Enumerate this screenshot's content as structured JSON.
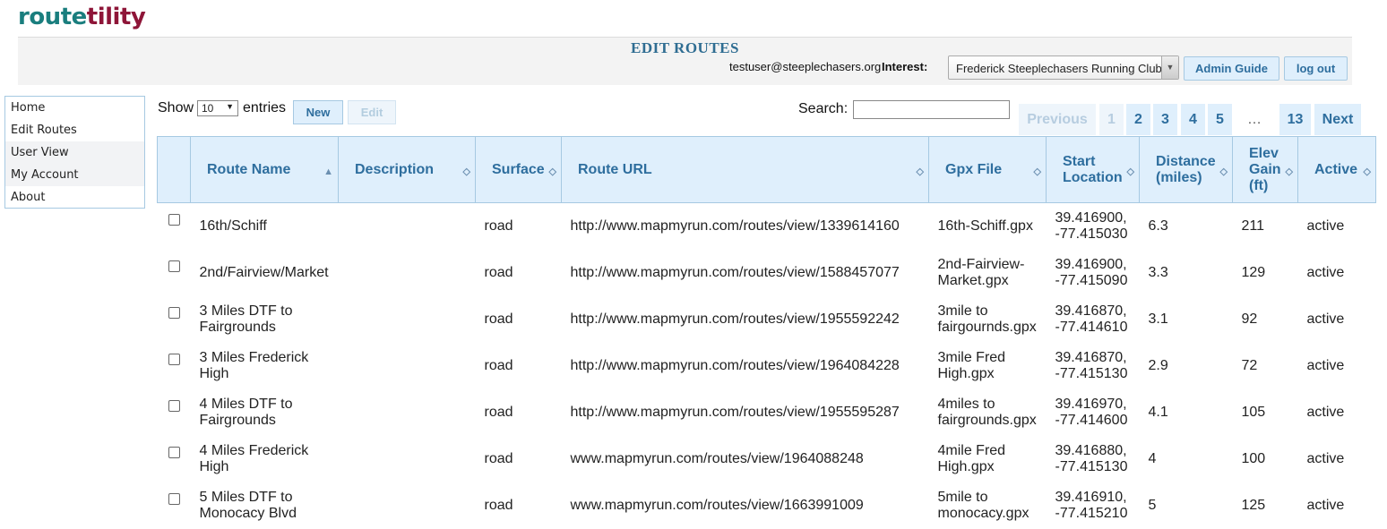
{
  "logo": {
    "part1": "route",
    "part2": "tility"
  },
  "header": {
    "title": "EDIT ROUTES",
    "user_email": "testuser@steeplechasers.org",
    "interest_label": "Interest:",
    "interest_value": "Frederick Steeplechasers Running Club",
    "admin_guide_label": "Admin Guide",
    "logout_label": "log out"
  },
  "nav": {
    "items": [
      "Home",
      "Edit Routes",
      "User View",
      "My Account",
      "About"
    ]
  },
  "toolbar": {
    "show_label": "Show",
    "entries_value": "10",
    "entries_label": "entries",
    "new_label": "New",
    "edit_label": "Edit",
    "search_label": "Search:",
    "search_value": ""
  },
  "pagination": {
    "previous": "Previous",
    "pages": [
      "1",
      "2",
      "3",
      "4",
      "5"
    ],
    "ellipsis": "…",
    "last": "13",
    "next": "Next",
    "current_page": "1"
  },
  "table": {
    "columns": [
      "Route Name",
      "Description",
      "Surface",
      "Route URL",
      "Gpx File",
      "Start Location",
      "Distance (miles)",
      "Elev Gain (ft)",
      "Active"
    ],
    "rows": [
      {
        "name": "16th/Schiff",
        "description": "",
        "surface": "road",
        "url": "http://www.mapmyrun.com/routes/view/1339614160",
        "gpx": "16th-Schiff.gpx",
        "start": "39.416900, -77.415030",
        "distance": "6.3",
        "elev": "211",
        "active": "active"
      },
      {
        "name": "2nd/Fairview/Market",
        "description": "",
        "surface": "road",
        "url": "http://www.mapmyrun.com/routes/view/1588457077",
        "gpx": "2nd-Fairview-Market.gpx",
        "start": "39.416900, -77.415090",
        "distance": "3.3",
        "elev": "129",
        "active": "active"
      },
      {
        "name": "3 Miles DTF to Fairgrounds",
        "description": "",
        "surface": "road",
        "url": "http://www.mapmyrun.com/routes/view/1955592242",
        "gpx": "3mile to fairgournds.gpx",
        "start": "39.416870, -77.414610",
        "distance": "3.1",
        "elev": "92",
        "active": "active"
      },
      {
        "name": "3 Miles Frederick High",
        "description": "",
        "surface": "road",
        "url": "http://www.mapmyrun.com/routes/view/1964084228",
        "gpx": "3mile Fred High.gpx",
        "start": "39.416870, -77.415130",
        "distance": "2.9",
        "elev": "72",
        "active": "active"
      },
      {
        "name": "4 Miles DTF to Fairgrounds",
        "description": "",
        "surface": "road",
        "url": "http://www.mapmyrun.com/routes/view/1955595287",
        "gpx": "4miles to fairgrounds.gpx",
        "start": "39.416970, -77.414600",
        "distance": "4.1",
        "elev": "105",
        "active": "active"
      },
      {
        "name": "4 Miles Frederick High",
        "description": "",
        "surface": "road",
        "url": "www.mapmyrun.com/routes/view/1964088248",
        "gpx": "4mile Fred High.gpx",
        "start": "39.416880, -77.415130",
        "distance": "4",
        "elev": "100",
        "active": "active"
      },
      {
        "name": "5 Miles DTF to Monocacy Blvd",
        "description": "",
        "surface": "road",
        "url": "www.mapmyrun.com/routes/view/1663991009",
        "gpx": "5mile to monocacy.gpx",
        "start": "39.416910, -77.415210",
        "distance": "5",
        "elev": "125",
        "active": "active"
      }
    ]
  },
  "colors": {
    "logo_teal": "#1a7e7e",
    "logo_maroon": "#8e1538",
    "header_blue": "#2e6e9e",
    "header_bg": "#dfeffc",
    "border_blue": "#a6c9e2"
  }
}
